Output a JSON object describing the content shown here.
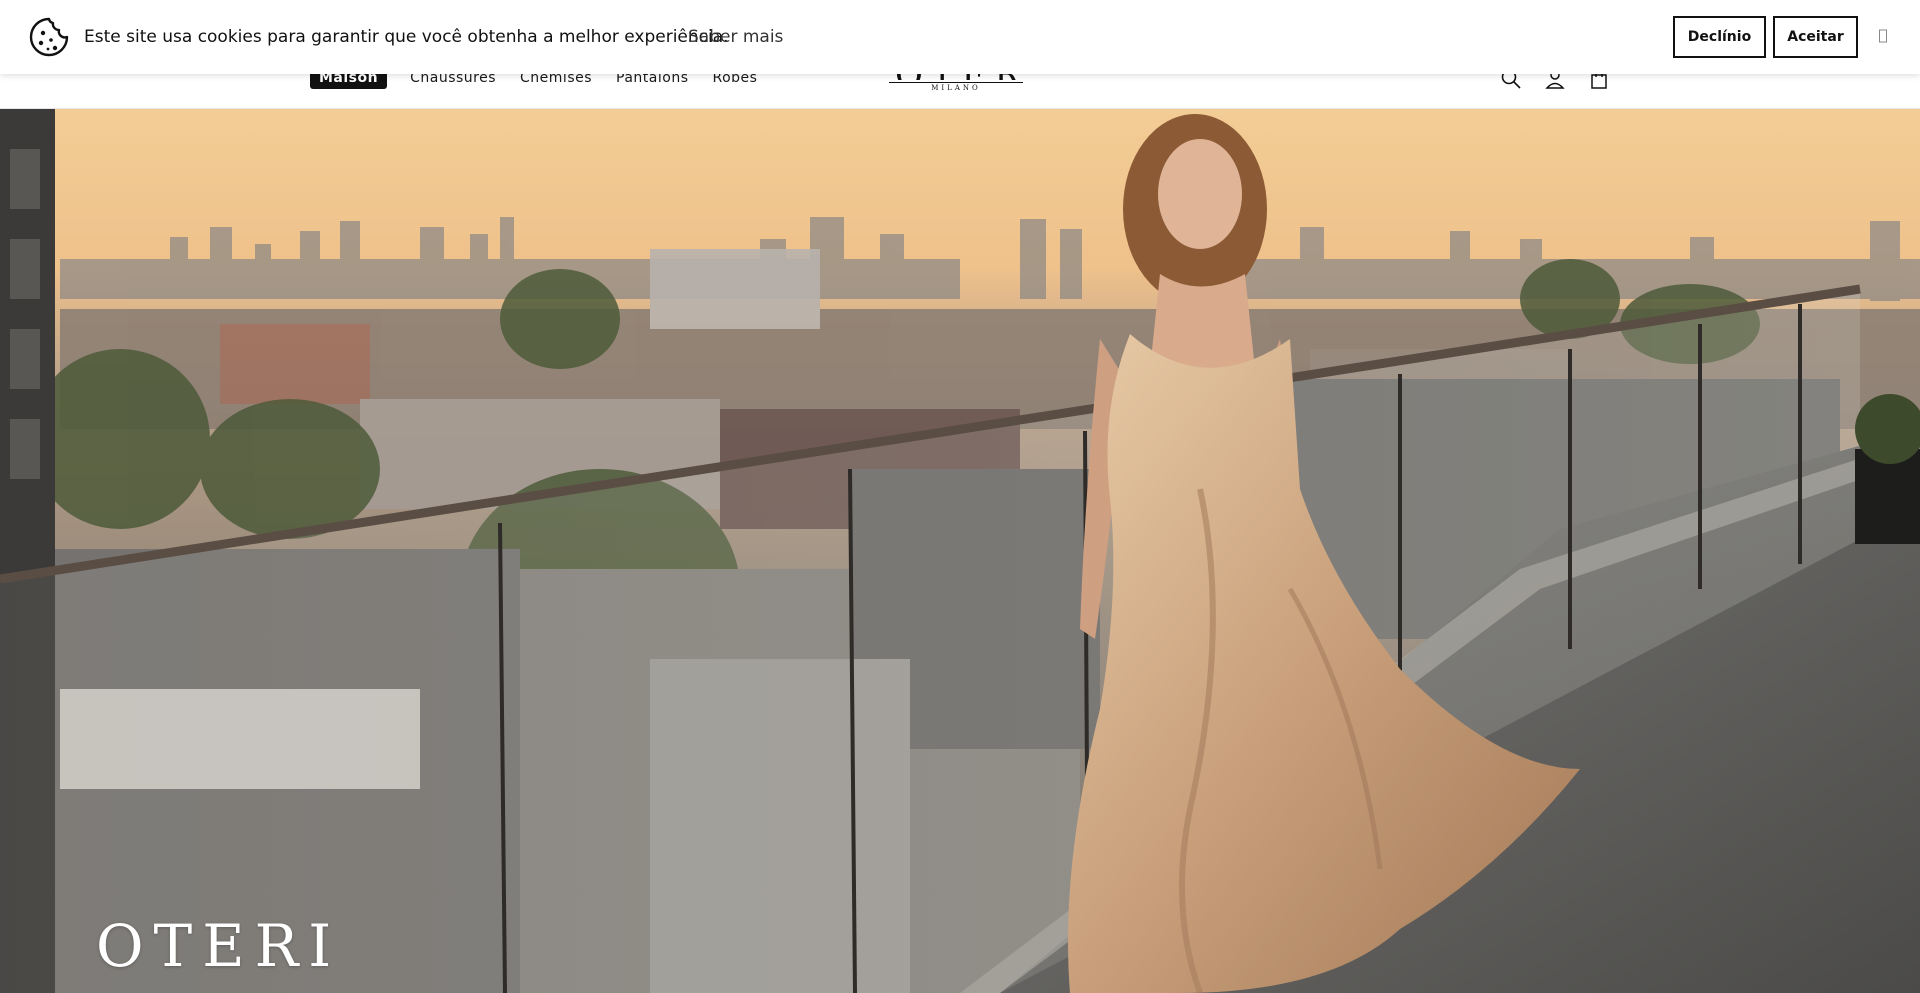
{
  "cookie_banner": {
    "message": "Este site usa cookies para garantir que você obtenha a melhor experiência.",
    "learn_more": "Saber mais",
    "decline": "Declínio",
    "accept": "Aceitar",
    "close_icon": "close-icon"
  },
  "header": {
    "nav": [
      {
        "label": "Maison",
        "active": true
      },
      {
        "label": "Chaussures",
        "active": false
      },
      {
        "label": "Chemises",
        "active": false
      },
      {
        "label": "Pantalons",
        "active": false
      },
      {
        "label": "Robes",
        "active": false
      }
    ],
    "logo": {
      "word": "OTERI",
      "sub": "MILANO"
    },
    "icons": [
      "search-icon",
      "account-icon",
      "cart-icon"
    ]
  },
  "hero": {
    "title": "OTERI"
  },
  "colors": {
    "text": "#111111",
    "banner_bg": "#ffffff",
    "active_nav_bg": "#111111",
    "sky_top": "#f3c98e",
    "sky_bottom": "#c9a98a",
    "dress": "#d8b591"
  }
}
